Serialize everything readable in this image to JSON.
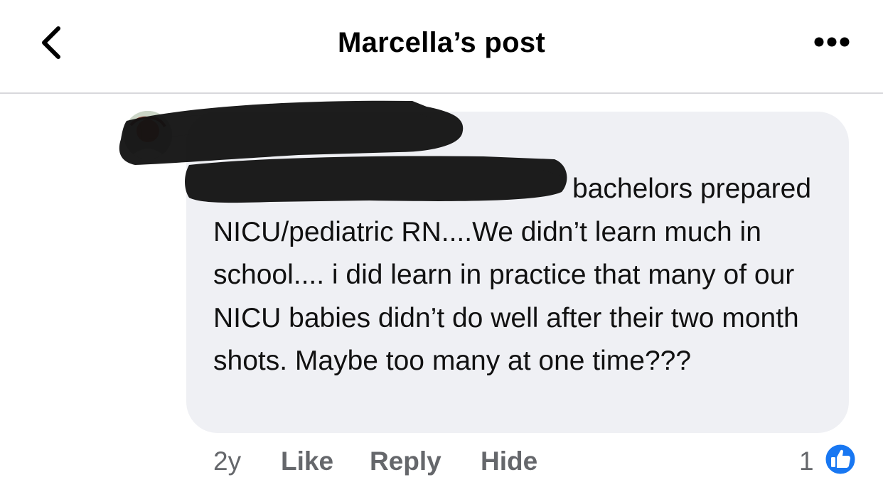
{
  "header": {
    "title": "Marcella’s post",
    "back_icon": "chevron-left-icon",
    "more_icon": "more-horizontal-icon"
  },
  "comment": {
    "text": "bachelors prepared NICU/pediatric RN....We didn’t learn much in school.... i did learn in practice that many of our NICU babies didn’t do well after their two month shots. Maybe too many at one time???",
    "author_redacted": true,
    "avatar_icon": "user-avatar"
  },
  "actions": {
    "time": "2y",
    "like_label": "Like",
    "reply_label": "Reply",
    "hide_label": "Hide",
    "like_count": "1",
    "like_icon": "thumbs-up-icon"
  },
  "colors": {
    "bubble_bg": "#eff0f4",
    "meta_text": "#65676b",
    "like_blue": "#1877f2"
  }
}
